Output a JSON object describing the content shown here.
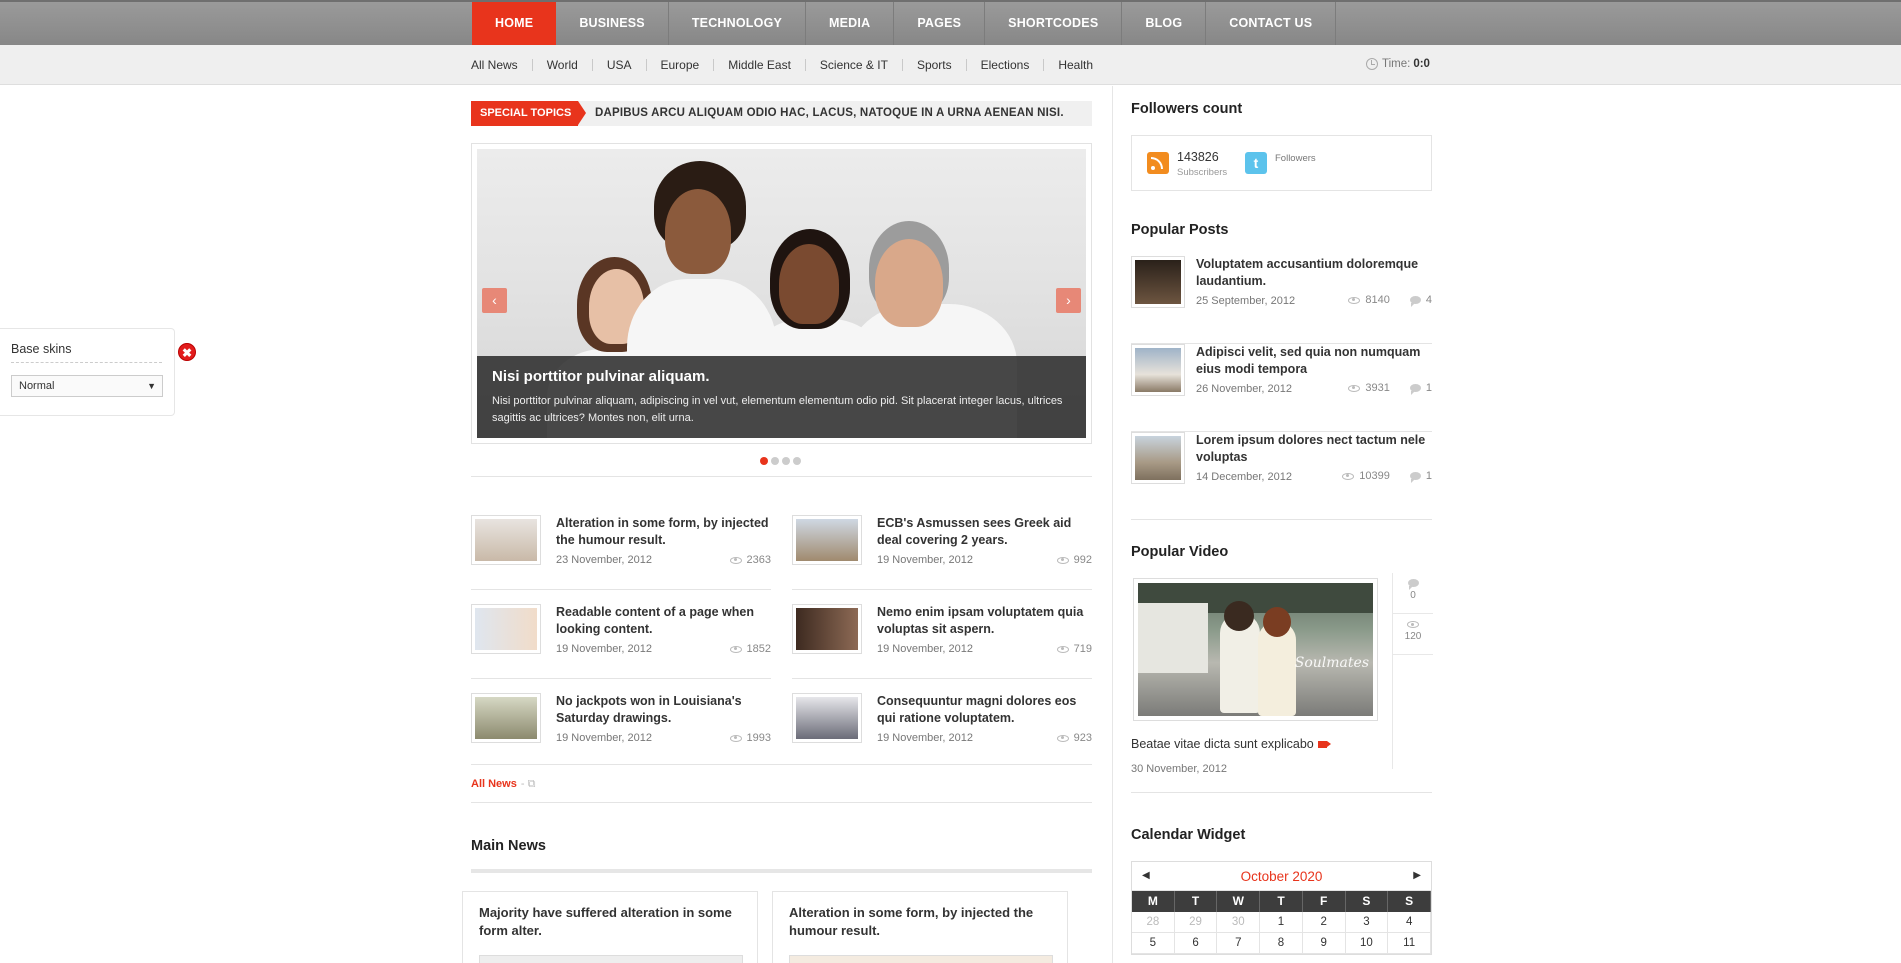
{
  "top_nav": [
    "HOME",
    "BUSINESS",
    "TECHNOLOGY",
    "MEDIA",
    "PAGES",
    "SHORTCODES",
    "BLOG",
    "CONTACT US"
  ],
  "sub_nav": [
    "All News",
    "World",
    "USA",
    "Europe",
    "Middle East",
    "Science & IT",
    "Sports",
    "Elections",
    "Health"
  ],
  "time": {
    "label": "Time:",
    "value": "0:0"
  },
  "skin_panel": {
    "title": "Base skins",
    "selected": "Normal"
  },
  "ticker": {
    "label": "SPECIAL TOPICS",
    "text": "DAPIBUS ARCU ALIQUAM ODIO HAC, LACUS, NATOQUE IN A URNA AENEAN NISI."
  },
  "slider": {
    "title": "Nisi porttitor pulvinar aliquam.",
    "text": "Nisi porttitor pulvinar aliquam, adipiscing in vel vut, elementum elementum odio pid. Sit placerat integer lacus, ultrices sagittis ac ultrices? Montes non, elit urna."
  },
  "news": [
    {
      "title": "Alteration in some form, by injected the humour result.",
      "date": "23 November, 2012",
      "views": "2363",
      "thumb": "#c9b9a8"
    },
    {
      "title": "ECB's Asmussen sees Greek aid deal covering 2 years.",
      "date": "19 November, 2012",
      "views": "992",
      "thumb": "#a08a6e"
    },
    {
      "title": "Readable content of a page when looking content.",
      "date": "19 November, 2012",
      "views": "1852",
      "thumb": "#dfe6ef"
    },
    {
      "title": "Nemo enim ipsam voluptatem quia voluptas sit aspern.",
      "date": "19 November, 2012",
      "views": "719",
      "thumb": "#6b4e3d"
    },
    {
      "title": "No jackpots won in Louisiana's Saturday drawings.",
      "date": "19 November, 2012",
      "views": "1993",
      "thumb": "#b9b79a"
    },
    {
      "title": "Consequuntur magni dolores eos qui ratione voluptatem.",
      "date": "19 November, 2012",
      "views": "923",
      "thumb": "#8e8f98"
    }
  ],
  "all_news": "All News",
  "main_news": {
    "heading": "Main News",
    "cards": [
      {
        "title": "Majority have suffered alteration in some form alter."
      },
      {
        "title": "Alteration in some form, by injected the humour result."
      }
    ]
  },
  "followers": {
    "heading": "Followers count",
    "subscribers_count": "143826",
    "subscribers_label": "Subscribers",
    "twitter_label": "Followers"
  },
  "popular_posts": {
    "heading": "Popular Posts",
    "items": [
      {
        "title": "Voluptatem accusantium doloremque laudantium.",
        "date": "25 September, 2012",
        "views": "8140",
        "comments": "4",
        "thumb": "#4b3a2c"
      },
      {
        "title": "Adipisci velit, sed quia non numquam eius modi tempora",
        "date": "26 November, 2012",
        "views": "3931",
        "comments": "1",
        "thumb": "#9fb3c8"
      },
      {
        "title": "Lorem ipsum dolores nect tactum nele voluptas",
        "date": "14 December, 2012",
        "views": "10399",
        "comments": "1",
        "thumb": "#a89a86"
      }
    ]
  },
  "popular_video": {
    "heading": "Popular Video",
    "comments": "0",
    "views": "120",
    "watermark": "Soulmates",
    "title": "Beatae vitae dicta sunt explicabo",
    "date": "30 November, 2012"
  },
  "calendar": {
    "heading": "Calendar Widget",
    "month": "October 2020",
    "weekdays": [
      "M",
      "T",
      "W",
      "T",
      "F",
      "S",
      "S"
    ],
    "days": [
      {
        "d": "28",
        "muted": true
      },
      {
        "d": "29",
        "muted": true
      },
      {
        "d": "30",
        "muted": true
      },
      {
        "d": "1"
      },
      {
        "d": "2"
      },
      {
        "d": "3"
      },
      {
        "d": "4"
      },
      {
        "d": "5"
      },
      {
        "d": "6"
      },
      {
        "d": "7"
      },
      {
        "d": "8"
      },
      {
        "d": "9"
      },
      {
        "d": "10"
      },
      {
        "d": "11"
      }
    ]
  },
  "colors": {
    "accent": "#e8341c",
    "nav_bg": "#8f8f8f",
    "subnav_bg": "#efefef"
  }
}
